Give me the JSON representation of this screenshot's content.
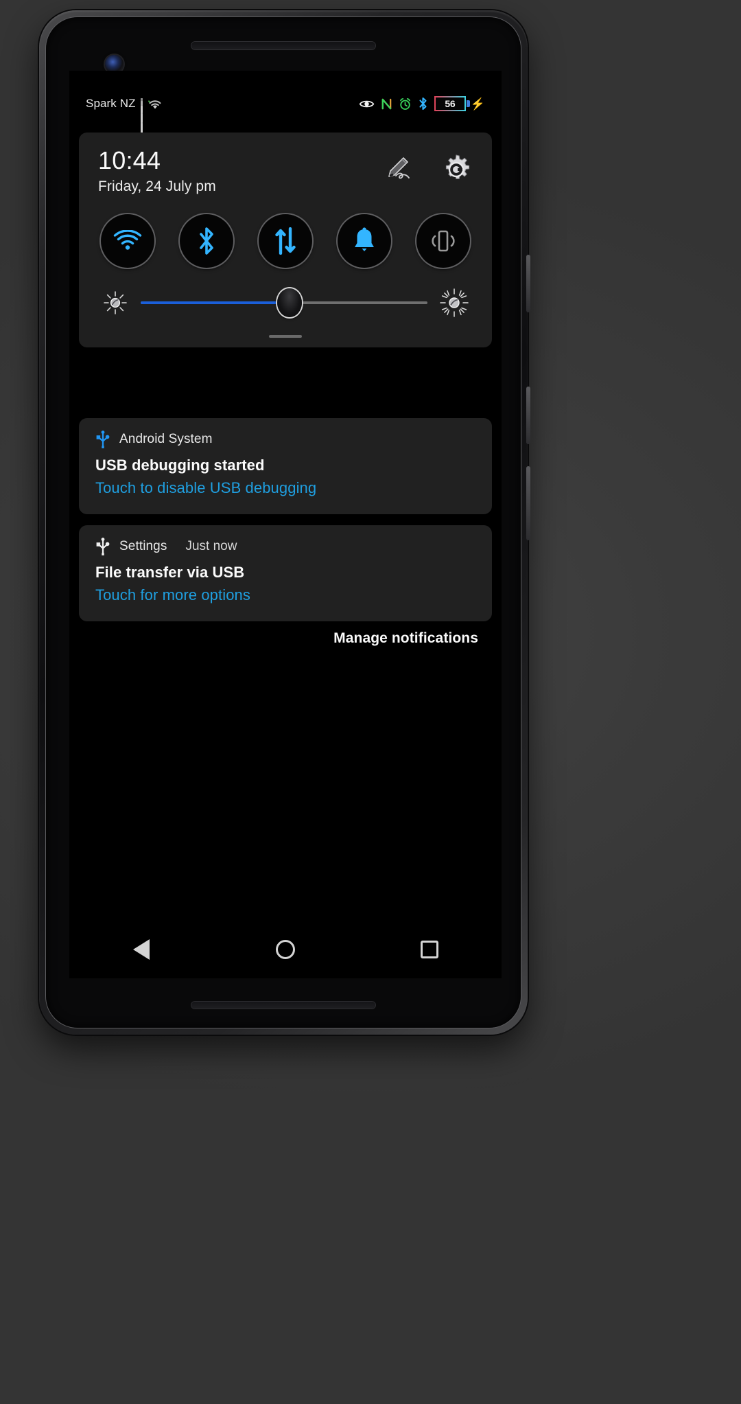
{
  "statusbar": {
    "carrier": "Spark NZ",
    "icons": {
      "signal": "signal-bars-icon",
      "wifi": "wifi-icon",
      "eye": "eye-icon",
      "nfc": "N",
      "alarm": "alarm-clock-icon",
      "bluetooth": "bluetooth-icon",
      "charging": "charging-bolt-icon"
    },
    "battery_percent": "56"
  },
  "quick_settings": {
    "clock": "10:44",
    "date": "Friday, 24 July  pm",
    "edit_icon": "pencil-edit-icon",
    "settings_icon": "gear-icon",
    "tiles": [
      {
        "name": "wifi",
        "icon": "wifi-icon",
        "active": true
      },
      {
        "name": "bluetooth",
        "icon": "bluetooth-icon",
        "active": true
      },
      {
        "name": "mobile-data",
        "icon": "data-transfer-icon",
        "active": true
      },
      {
        "name": "sound",
        "icon": "bell-icon",
        "active": true
      },
      {
        "name": "vibrate",
        "icon": "vibrate-icon",
        "active": false
      }
    ],
    "brightness": {
      "low_icon": "brightness-low-icon",
      "high_icon": "brightness-high-icon",
      "value_percent": 52
    }
  },
  "notifications": [
    {
      "icon": "usb-icon",
      "icon_color": "#2196f3",
      "app": "Android System",
      "time": "",
      "title": "USB debugging started",
      "subtitle": "Touch to disable USB debugging"
    },
    {
      "icon": "usb-icon",
      "icon_color": "#f0f0f0",
      "app": "Settings",
      "time": "Just now",
      "title": "File transfer via USB",
      "subtitle": "Touch for more options"
    }
  ],
  "manage": {
    "label": "Manage notifications"
  },
  "navbar": {
    "back": "back-triangle-icon",
    "home": "home-circle-icon",
    "recents": "recents-square-icon"
  },
  "colors": {
    "accent_blue": "#2196f3",
    "link_blue": "#1f9fe0",
    "slider_blue": "#1b5fd9",
    "panel_bg": "#1f1f1f",
    "notif_bg": "#212121",
    "screen_bg": "#000000"
  }
}
